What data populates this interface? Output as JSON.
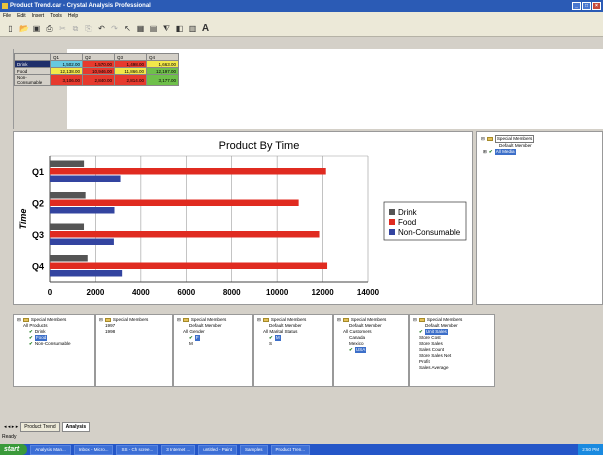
{
  "window": {
    "title": "Product Trend.car - Crystal Analysis Professional"
  },
  "menu": [
    "File",
    "Edit",
    "Insert",
    "Tools",
    "Help"
  ],
  "toolbar": {
    "a_label": "A"
  },
  "grid": {
    "columns": [
      "Q1",
      "Q2",
      "Q3",
      "Q4"
    ],
    "rows": [
      {
        "label": "Drink",
        "values": [
          "1,502.00",
          "1,570.00",
          "1,498.00",
          "1,663.00"
        ],
        "colors": [
          "#66c9e0",
          "#e63a2e",
          "#e63a2e",
          "#f2e84a"
        ]
      },
      {
        "label": "Food",
        "values": [
          "12,138.00",
          "10,946.00",
          "11,866.00",
          "12,197.00"
        ],
        "colors": [
          "#f2e84a",
          "#e63a2e",
          "#f2e84a",
          "#6fc04a"
        ]
      },
      {
        "label": "Non-Consumable",
        "values": [
          "3,106.00",
          "2,840.00",
          "2,814.00",
          "3,177.00"
        ],
        "colors": [
          "#e63a2e",
          "#e63a2e",
          "#e63a2e",
          "#6fc04a"
        ]
      }
    ]
  },
  "chart_data": {
    "type": "bar",
    "orientation": "horizontal",
    "title": "Product By Time",
    "ylabel": "Time",
    "xlabel": "",
    "categories": [
      "Q1",
      "Q2",
      "Q3",
      "Q4"
    ],
    "series": [
      {
        "name": "Drink",
        "color": "#555555",
        "values": [
          1502,
          1570,
          1498,
          1663
        ]
      },
      {
        "name": "Food",
        "color": "#e02b20",
        "values": [
          12138,
          10946,
          11866,
          12197
        ]
      },
      {
        "name": "Non-Consumable",
        "color": "#3344a0",
        "values": [
          3106,
          2840,
          2814,
          3177
        ]
      }
    ],
    "xlim": [
      0,
      14000
    ],
    "xticks": [
      "0",
      "2000",
      "4000",
      "6000",
      "8000",
      "10000",
      "12000",
      "14000"
    ],
    "grid": true,
    "legend": "right"
  },
  "special_top": {
    "header": "Special Members",
    "default": "Default Member",
    "all": "All Media"
  },
  "member_panels": [
    {
      "header": "Special Members",
      "items": [
        {
          "text": "All Products",
          "indent": 1
        },
        {
          "text": "Drink",
          "indent": 2,
          "check": true
        },
        {
          "text": "Food",
          "indent": 2,
          "check": true,
          "selected": true
        },
        {
          "text": "Non-Consumable",
          "indent": 2,
          "check": true
        }
      ]
    },
    {
      "header": "Special Members",
      "items": [
        {
          "text": "1997",
          "indent": 1
        },
        {
          "text": "1998",
          "indent": 1
        }
      ]
    },
    {
      "header": "Special Members",
      "items": [
        {
          "text": "Default Member",
          "indent": 2
        },
        {
          "text": "All Gender",
          "indent": 1
        },
        {
          "text": "F",
          "indent": 2,
          "check": true,
          "selected": true
        },
        {
          "text": "M",
          "indent": 2
        }
      ]
    },
    {
      "header": "Special Members",
      "items": [
        {
          "text": "Default Member",
          "indent": 2
        },
        {
          "text": "All Marital Status",
          "indent": 1
        },
        {
          "text": "M",
          "indent": 2,
          "check": true,
          "selected": true
        },
        {
          "text": "S",
          "indent": 2
        }
      ]
    },
    {
      "header": "Special Members",
      "items": [
        {
          "text": "Default Member",
          "indent": 2
        },
        {
          "text": "All Customers",
          "indent": 1
        },
        {
          "text": "Canada",
          "indent": 2
        },
        {
          "text": "Mexico",
          "indent": 2
        },
        {
          "text": "USA",
          "indent": 2,
          "check": true,
          "selected": true
        }
      ]
    },
    {
      "header": "Special Members",
      "items": [
        {
          "text": "Default Member",
          "indent": 2
        },
        {
          "text": "Unit Sales",
          "indent": 1,
          "check": true,
          "selected": true
        },
        {
          "text": "Store Cost",
          "indent": 1
        },
        {
          "text": "Store Sales",
          "indent": 1
        },
        {
          "text": "Sales Count",
          "indent": 1
        },
        {
          "text": "Store Sales Net",
          "indent": 1
        },
        {
          "text": "Profit",
          "indent": 1
        },
        {
          "text": "Sales Average",
          "indent": 1
        }
      ]
    }
  ],
  "tabs": [
    "Product Trend",
    "Analysis"
  ],
  "status": "Ready",
  "taskbar": {
    "start": "start",
    "tasks": [
      "Analysis Man...",
      "Inbox - Micro...",
      "SS - Ch scree...",
      "3 Internet ...",
      "untitled - Paint",
      "Samples",
      "Product Tren..."
    ],
    "clock": "2:50 PM"
  }
}
